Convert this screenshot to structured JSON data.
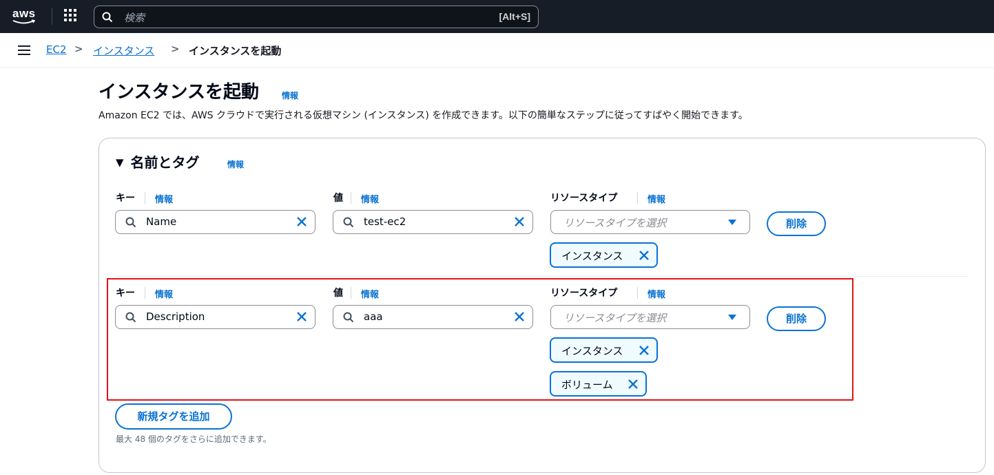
{
  "header": {
    "logo": "aws",
    "search_placeholder": "検索",
    "search_shortcut": "[Alt+S]"
  },
  "breadcrumb": {
    "items": [
      "EC2",
      "インスタンス"
    ],
    "current": "インスタンスを起動"
  },
  "page": {
    "title": "インスタンスを起動",
    "info": "情報",
    "description": "Amazon EC2 では、AWS クラウドで実行される仮想マシン (インスタンス) を作成できます。以下の簡単なステップに従ってすばやく開始できます。"
  },
  "section": {
    "title": "名前とタグ",
    "info": "情報",
    "tags": [
      {
        "key_label": "キー",
        "key_info": "情報",
        "key_value": "Name",
        "value_label": "値",
        "value_info": "情報",
        "value_value": "test-ec2",
        "rt_label": "リソースタイプ",
        "rt_info": "情報",
        "rt_placeholder": "リソースタイプを選択",
        "delete_label": "削除",
        "tokens": [
          "インスタンス"
        ]
      },
      {
        "key_label": "キー",
        "key_info": "情報",
        "key_value": "Description",
        "value_label": "値",
        "value_info": "情報",
        "value_value": "aaa",
        "rt_label": "リソースタイプ",
        "rt_info": "情報",
        "rt_placeholder": "リソースタイプを選択",
        "delete_label": "削除",
        "tokens": [
          "インスタンス",
          "ボリューム"
        ]
      }
    ],
    "add_tag_label": "新規タグを追加",
    "limit_hint": "最大 48 個のタグをさらに追加できます。"
  },
  "colors": {
    "accent": "#0972d3",
    "topbar": "#161d26",
    "highlight": "#e0121b"
  }
}
